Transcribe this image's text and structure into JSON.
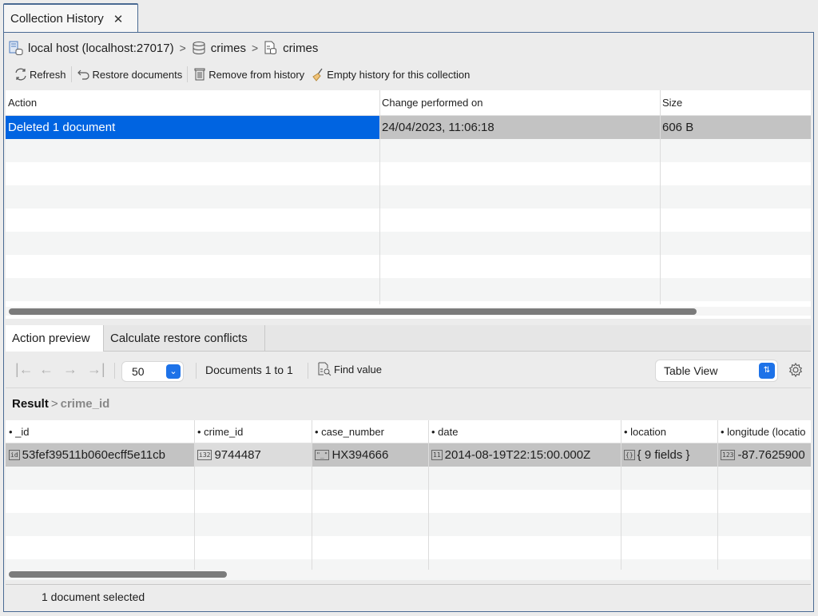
{
  "tab": {
    "title": "Collection History",
    "close_icon": "close-icon"
  },
  "breadcrumb": [
    {
      "icon": "server-icon",
      "label": "local host (localhost:27017)"
    },
    {
      "icon": "database-icon",
      "label": "crimes"
    },
    {
      "icon": "collection-icon",
      "label": "crimes"
    }
  ],
  "toolbar": {
    "refresh": "Refresh",
    "restore": "Restore documents",
    "remove": "Remove from history",
    "empty": "Empty history for this collection"
  },
  "history": {
    "columns": [
      "Action",
      "Change performed on",
      "Size"
    ],
    "rows": [
      {
        "action": "Deleted 1 document",
        "date": "24/04/2023, 11:06:18",
        "size": "606 B",
        "selected": true
      }
    ]
  },
  "preview_tabs": [
    "Action preview",
    "Calculate restore conflicts"
  ],
  "pager": {
    "page_size": "50",
    "range": "Documents 1 to 1",
    "find_value": "Find value",
    "view_mode": "Table View"
  },
  "result_path": {
    "root": "Result",
    "field": "crime_id"
  },
  "grid": {
    "columns": [
      "_id",
      "crime_id",
      "case_number",
      "date",
      "location",
      "longitude (locatio"
    ],
    "rows": [
      {
        "_id": {
          "type": "id",
          "value": "53fef39511b060ecff5e11cb"
        },
        "crime_id": {
          "type": "i32",
          "value": "9744487"
        },
        "case_number": {
          "type": "\"_\"",
          "value": "HX394666"
        },
        "date": {
          "type": "11",
          "value": "2014-08-19T22:15:00.000Z"
        },
        "location": {
          "type": "{}",
          "value": "{ 9 fields }"
        },
        "longitude": {
          "type": "123",
          "value": "-87.7625900"
        }
      }
    ]
  },
  "status": "1 document selected",
  "colors": {
    "selection": "#0064e1",
    "row_selected_gray": "#c3c3c3",
    "frame_border": "#4a6a93",
    "accent_blue": "#1d72e8"
  }
}
